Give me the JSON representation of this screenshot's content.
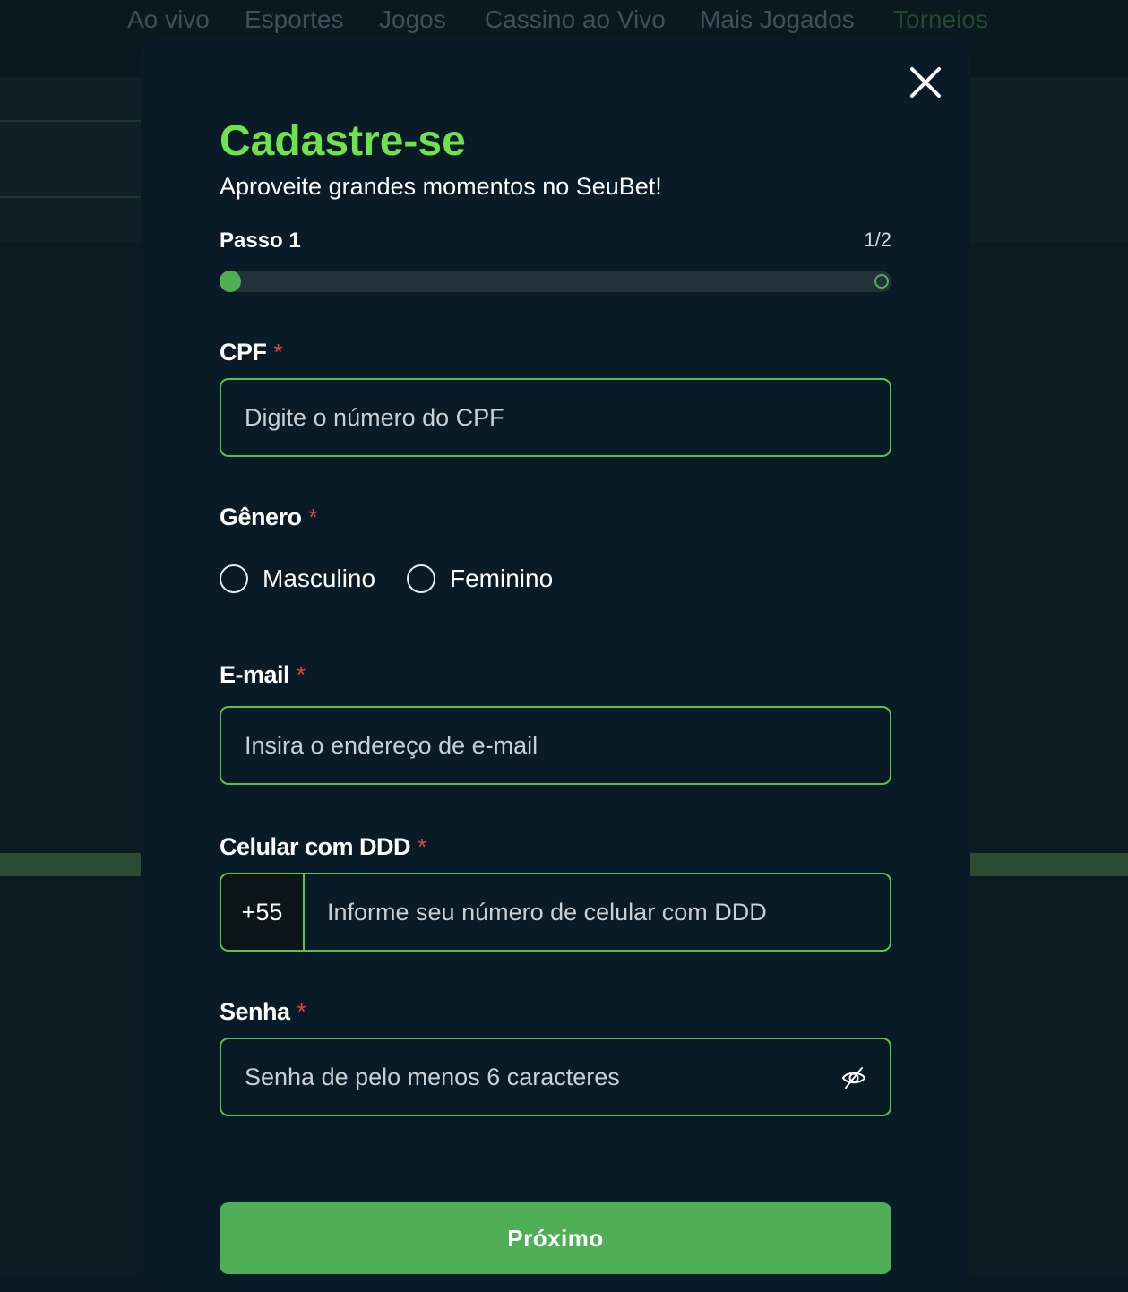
{
  "background_nav": {
    "items": [
      {
        "label": "Ao vivo"
      },
      {
        "label": "Esportes"
      },
      {
        "label": "Jogos"
      },
      {
        "label": "Cassino ao Vivo"
      },
      {
        "label": "Mais Jogados"
      },
      {
        "label": "Torneios",
        "active": true
      }
    ]
  },
  "modal": {
    "title": "Cadastre-se",
    "subtitle": "Aproveite grandes momentos no SeuBet!",
    "close_icon": "close-icon",
    "step": {
      "label": "Passo 1",
      "count": "1/2",
      "current": 1,
      "total": 2
    },
    "required_marker": "*",
    "fields": {
      "cpf": {
        "label": "CPF",
        "placeholder": "Digite o número do CPF",
        "value": ""
      },
      "gender": {
        "label": "Gênero",
        "options": [
          "Masculino",
          "Feminino"
        ],
        "selected": null
      },
      "email": {
        "label": "E-mail",
        "placeholder": "Insira o endereço de e-mail",
        "value": ""
      },
      "phone": {
        "label": "Celular com DDD",
        "prefix": "+55",
        "placeholder": "Informe seu número de celular com DDD",
        "value": ""
      },
      "password": {
        "label": "Senha",
        "placeholder": "Senha de pelo menos 6 caracteres",
        "value": "",
        "toggle_icon": "eye-slash-icon"
      }
    },
    "next_button": "Próximo"
  },
  "colors": {
    "accent_green": "#6fe24e",
    "button_green": "#4fae56",
    "input_border": "#5fbf4a",
    "required_red": "#e0464b",
    "modal_bg": "#081b26"
  }
}
